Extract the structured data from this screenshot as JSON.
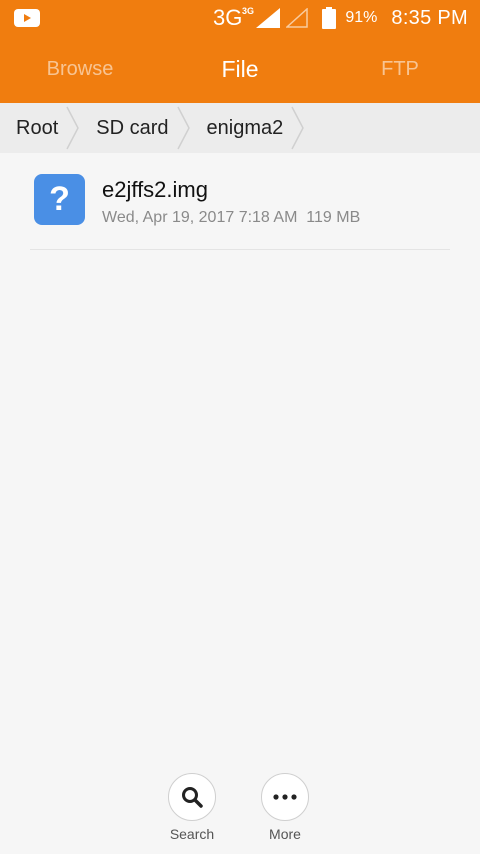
{
  "status_bar": {
    "network": "3G",
    "network_small": "3G",
    "battery": "91%",
    "time": "8:35 PM",
    "icons": [
      "youtube-icon",
      "signal-icon",
      "signal-empty-icon",
      "battery-icon"
    ]
  },
  "tabs": [
    {
      "label": "Browse",
      "active": false
    },
    {
      "label": "File",
      "active": true
    },
    {
      "label": "FTP",
      "active": false
    }
  ],
  "breadcrumb": [
    "Root",
    "SD card",
    "enigma2"
  ],
  "files": [
    {
      "name": "e2jffs2.img",
      "date": "Wed, Apr 19, 2017 7:18 AM",
      "size": "119 MB",
      "icon": "unknown-file-icon"
    }
  ],
  "actions": {
    "search": "Search",
    "more": "More"
  },
  "colors": {
    "accent": "#f07d0f",
    "file_icon": "#4a8fe5",
    "background": "#f6f6f6"
  }
}
